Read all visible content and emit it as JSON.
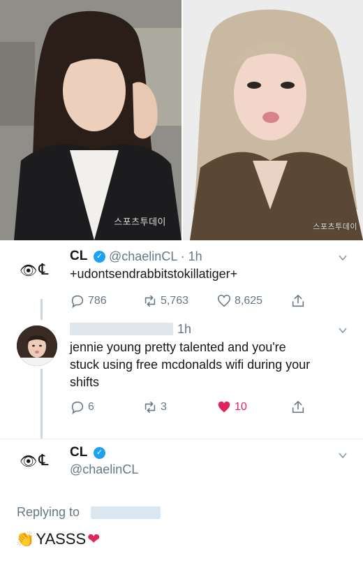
{
  "photos": {
    "left_watermark": "스포츠투데이",
    "right_watermark": "스포츠투데이"
  },
  "tweet1": {
    "avatar_text": "℄",
    "name": "CL",
    "handle": "@chaelinCL · 1h",
    "text": "+udontsendrabbitstokillatiger+",
    "replies": "786",
    "retweets": "5,763",
    "likes": "8,625"
  },
  "reply": {
    "time": "1h",
    "text_line1": "jennie young pretty talented and you're",
    "text_line2": "stuck using free mcdonalds wifi during your",
    "text_line3": "shifts",
    "replies": "6",
    "retweets": "3",
    "likes": "10"
  },
  "main": {
    "avatar_text": "℄",
    "name": "CL",
    "handle": "@chaelinCL",
    "replying_to": "Replying to",
    "text": "YASSS",
    "emoji_left": "👏",
    "emoji_right": "❤"
  },
  "colors": {
    "accent": "#1da1f2",
    "muted": "#657786",
    "like_red": "#e0245e"
  }
}
